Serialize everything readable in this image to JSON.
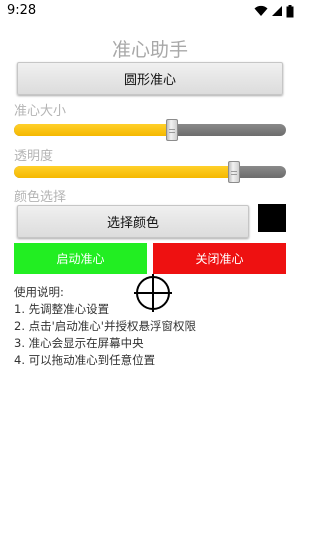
{
  "status_bar": {
    "time": "9:28",
    "icons": [
      "wifi-icon",
      "signal-icon",
      "battery-icon"
    ]
  },
  "app": {
    "title": "准心助手"
  },
  "mode_button": {
    "label": "圆形准心"
  },
  "size_setting": {
    "label": "准心大小",
    "value_fraction": 0.58
  },
  "opacity_setting": {
    "label": "透明度",
    "value_fraction": 0.81
  },
  "color_setting": {
    "label": "颜色选择",
    "button_label": "选择颜色",
    "selected_color": "#000000"
  },
  "actions": {
    "start_label": "启动准心",
    "start_color": "#22ee22",
    "stop_label": "关闭准心",
    "stop_color": "#ee1111"
  },
  "instructions": {
    "title": "使用说明:",
    "steps": [
      "1. 先调整准心设置",
      "2. 点击'启动准心'并授权悬浮窗权限",
      "3. 准心会显示在屏幕中央",
      "4. 可以拖动准心到任意位置"
    ]
  },
  "colors": {
    "slider_fill": "#f5b800",
    "slider_track": "#707070",
    "title_text": "#a8a8a8",
    "label_text": "#b4b4b4"
  }
}
